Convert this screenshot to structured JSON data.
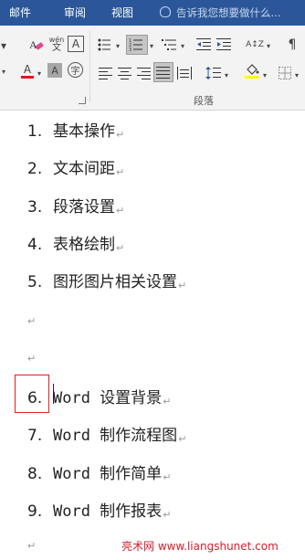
{
  "tabs": [
    {
      "label": "邮件"
    },
    {
      "label": "审阅"
    },
    {
      "label": "视图"
    }
  ],
  "tell_me": {
    "text": "告诉我您想要做什么..."
  },
  "ribbon": {
    "paragraph_group_label": "段落",
    "phonetic_top": "wén",
    "phonetic_bottom": "文",
    "char_border": "A",
    "font_color_letter": "A",
    "char_shading_letter": "A",
    "enclose_char": "字",
    "sort_icon": "A↕Z",
    "colors": {
      "accent": "#2b579a",
      "font_color_bar": "#e81123",
      "highlight_bar": "#ffff00"
    }
  },
  "document": {
    "lines": [
      {
        "num": "1.",
        "text": "基本操作"
      },
      {
        "num": "2.",
        "text": "文本间距"
      },
      {
        "num": "3.",
        "text": "段落设置"
      },
      {
        "num": "4.",
        "text": "表格绘制"
      },
      {
        "num": "5.",
        "text": "图形图片相关设置"
      },
      {
        "num": "6.",
        "text": "Word 设置背景"
      },
      {
        "num": "7.",
        "text": "Word 制作流程图"
      },
      {
        "num": "8.",
        "text": "Word 制作简单"
      },
      {
        "num": "9.",
        "text": "Word 制作报表"
      }
    ],
    "paragraph_mark": "↵"
  },
  "watermark": "亮术网 www.liangshunet.com"
}
